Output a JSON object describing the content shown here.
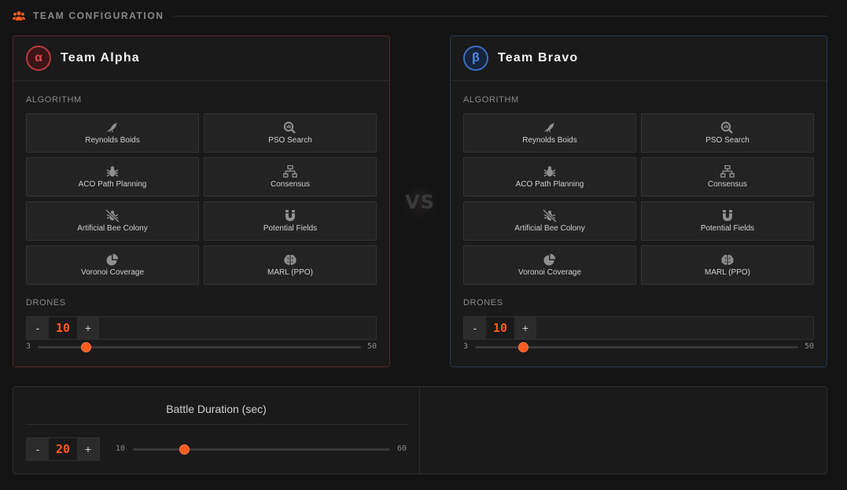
{
  "header": {
    "title": "TEAM CONFIGURATION"
  },
  "colors": {
    "accent": "#ff5a1f",
    "alpha": "#e0484f",
    "bravo": "#4d8ae6"
  },
  "vs_label": "VS",
  "teams": [
    {
      "badge": "α",
      "name": "Team Alpha",
      "algorithm_label": "ALGORITHM",
      "algorithms": [
        {
          "label": "Reynolds Boids",
          "icon": "crow-icon"
        },
        {
          "label": "PSO Search",
          "icon": "search-chart-icon"
        },
        {
          "label": "ACO Path Planning",
          "icon": "bug-icon"
        },
        {
          "label": "Consensus",
          "icon": "network-icon"
        },
        {
          "label": "Artificial Bee Colony",
          "icon": "bug-slash-icon"
        },
        {
          "label": "Potential Fields",
          "icon": "magnet-icon"
        },
        {
          "label": "Voronoi Coverage",
          "icon": "pie-chart-icon"
        },
        {
          "label": "MARL (PPO)",
          "icon": "brain-icon"
        }
      ],
      "drones_label": "DRONES",
      "drones": {
        "minus": "-",
        "value": "10",
        "plus": "+",
        "min": "3",
        "max": "50",
        "fraction": 0.149
      }
    },
    {
      "badge": "β",
      "name": "Team Bravo",
      "algorithm_label": "ALGORITHM",
      "algorithms": [
        {
          "label": "Reynolds Boids",
          "icon": "crow-icon"
        },
        {
          "label": "PSO Search",
          "icon": "search-chart-icon"
        },
        {
          "label": "ACO Path Planning",
          "icon": "bug-icon"
        },
        {
          "label": "Consensus",
          "icon": "network-icon"
        },
        {
          "label": "Artificial Bee Colony",
          "icon": "bug-slash-icon"
        },
        {
          "label": "Potential Fields",
          "icon": "magnet-icon"
        },
        {
          "label": "Voronoi Coverage",
          "icon": "pie-chart-icon"
        },
        {
          "label": "MARL (PPO)",
          "icon": "brain-icon"
        }
      ],
      "drones_label": "DRONES",
      "drones": {
        "minus": "-",
        "value": "10",
        "plus": "+",
        "min": "3",
        "max": "50",
        "fraction": 0.149
      }
    }
  ],
  "battle": {
    "title": "Battle Duration (sec)",
    "minus": "-",
    "value": "20",
    "plus": "+",
    "min": "10",
    "max": "60",
    "fraction": 0.2
  }
}
